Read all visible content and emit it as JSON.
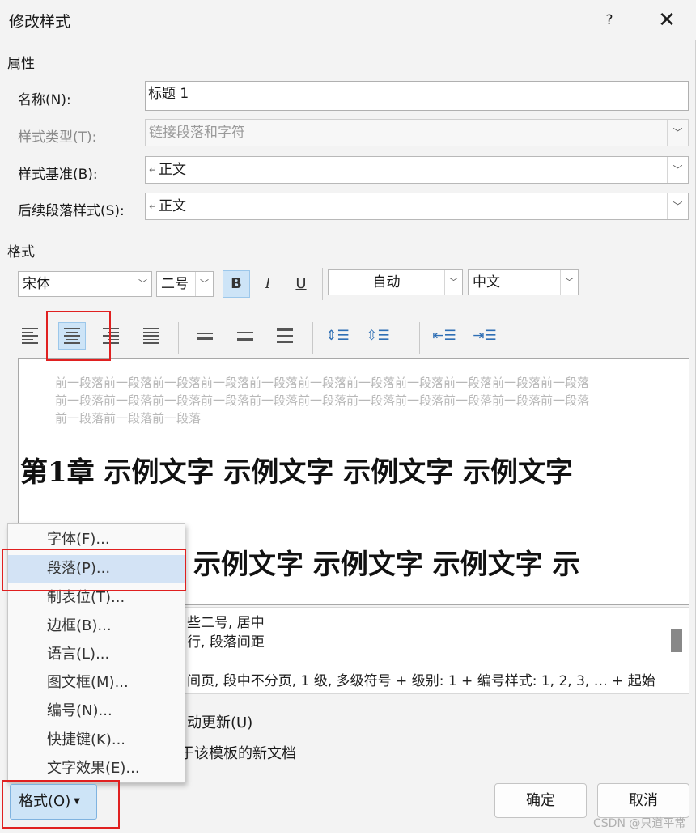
{
  "dialog": {
    "title": "修改样式",
    "help": "?",
    "close": "✕"
  },
  "properties": {
    "section": "属性",
    "name_label": "名称(N):",
    "name_value": "标题 1",
    "type_label": "样式类型(T):",
    "type_value": "链接段落和字符",
    "based_label": "样式基准(B):",
    "based_value": "正文",
    "next_label": "后续段落样式(S):",
    "next_value": "正文"
  },
  "format": {
    "section": "格式",
    "font": "宋体",
    "size": "二号",
    "bold": "B",
    "italic": "I",
    "underline": "U",
    "color": "自动",
    "script": "中文"
  },
  "preview": {
    "prev_lines": [
      "前一段落前一段落前一段落前一段落前一段落前一段落前一段落前一段落前一段落前一段落前一段落",
      "前一段落前一段落前一段落前一段落前一段落前一段落前一段落前一段落前一段落前一段落前一段落",
      "前一段落前一段落前一段落"
    ],
    "sample_line1": "第1章 示例文字 示例文字 示例文字 示例文字",
    "sample_line2": "示例文字 示例文字 示例文字 示"
  },
  "description": {
    "lines": [
      "些二号, 居中",
      "行, 段落间距",
      "间页, 段中不分页, 1 级, 多级符号 + 级别: 1 + 编号样式: 1, 2, 3, … + 起始"
    ]
  },
  "options": {
    "auto_update": "动更新(U)",
    "new_docs": "于该模板的新文档"
  },
  "menu": {
    "items": [
      "字体(F)...",
      "段落(P)...",
      "制表位(T)...",
      "边框(B)...",
      "语言(L)...",
      "图文框(M)...",
      "编号(N)...",
      "快捷键(K)...",
      "文字效果(E)..."
    ]
  },
  "buttons": {
    "format": "格式(O)",
    "ok": "确定",
    "cancel": "取消"
  },
  "watermark": "CSDN @只道平常"
}
